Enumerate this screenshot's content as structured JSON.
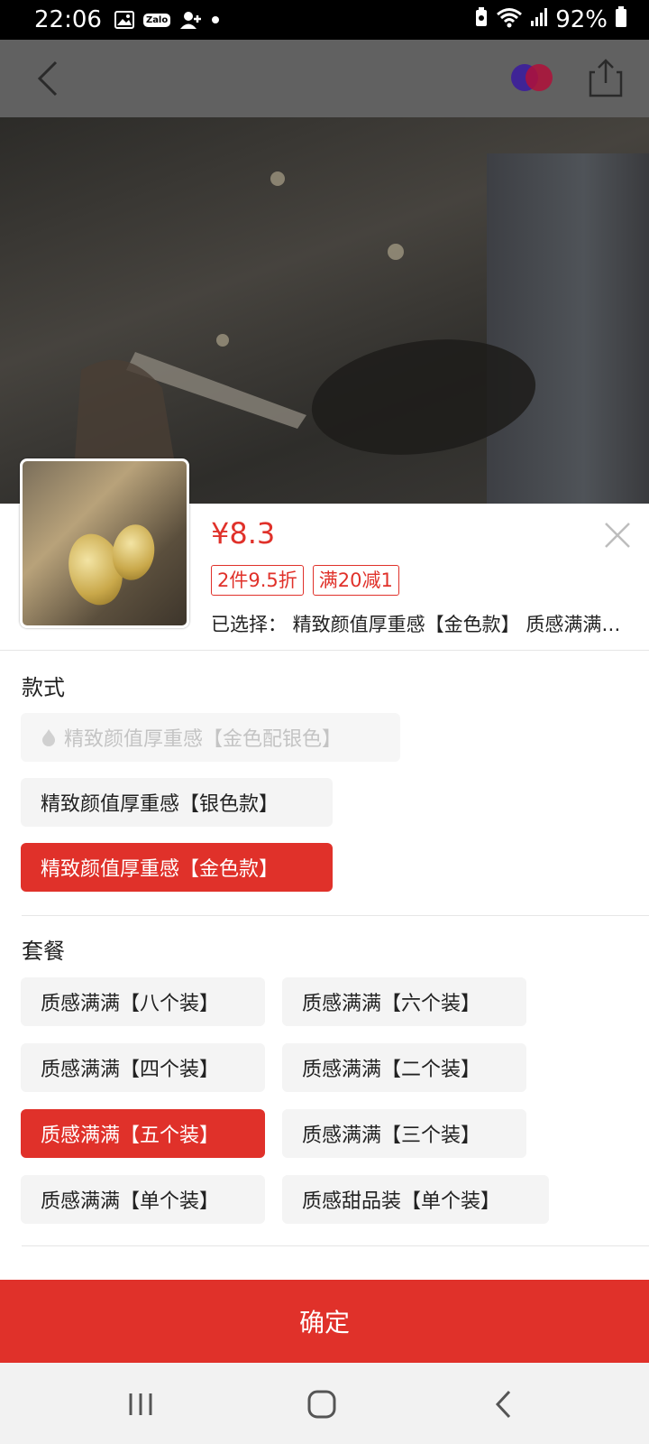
{
  "status_bar": {
    "time": "22:06",
    "battery": "92%",
    "icons": [
      "gallery-icon",
      "zalo-icon",
      "add-contact-icon",
      "notification-dot-icon",
      "battery-saver-icon",
      "wifi-icon",
      "signal-icon",
      "battery-icon"
    ],
    "zalo_text": "Zalo"
  },
  "colors": {
    "accent": "#e0312a",
    "option_bg": "#f4f4f4",
    "disabled_text": "#c4c4c4"
  },
  "product": {
    "price": "¥8.3",
    "tags": [
      "2件9.5折",
      "满20减1"
    ],
    "selected_text": "已选择：  精致颜值厚重感【金色款】 质感满满【五个装】"
  },
  "style_section": {
    "title": "款式",
    "options": [
      {
        "label": "精致颜值厚重感【金色配银色】",
        "state": "disabled"
      },
      {
        "label": "精致颜值厚重感【银色款】",
        "state": "normal"
      },
      {
        "label": "精致颜值厚重感【金色款】",
        "state": "selected"
      }
    ]
  },
  "package_section": {
    "title": "套餐",
    "options": [
      {
        "label": "质感满满【八个装】",
        "state": "normal"
      },
      {
        "label": "质感满满【六个装】",
        "state": "normal"
      },
      {
        "label": "质感满满【四个装】",
        "state": "normal"
      },
      {
        "label": "质感满满【二个装】",
        "state": "normal"
      },
      {
        "label": "质感满满【五个装】",
        "state": "selected"
      },
      {
        "label": "质感满满【三个装】",
        "state": "normal"
      },
      {
        "label": "质感满满【单个装】",
        "state": "normal"
      },
      {
        "label": "质感甜品装【单个装】",
        "state": "normal"
      }
    ]
  },
  "footer": {
    "confirm_label": "确定"
  }
}
